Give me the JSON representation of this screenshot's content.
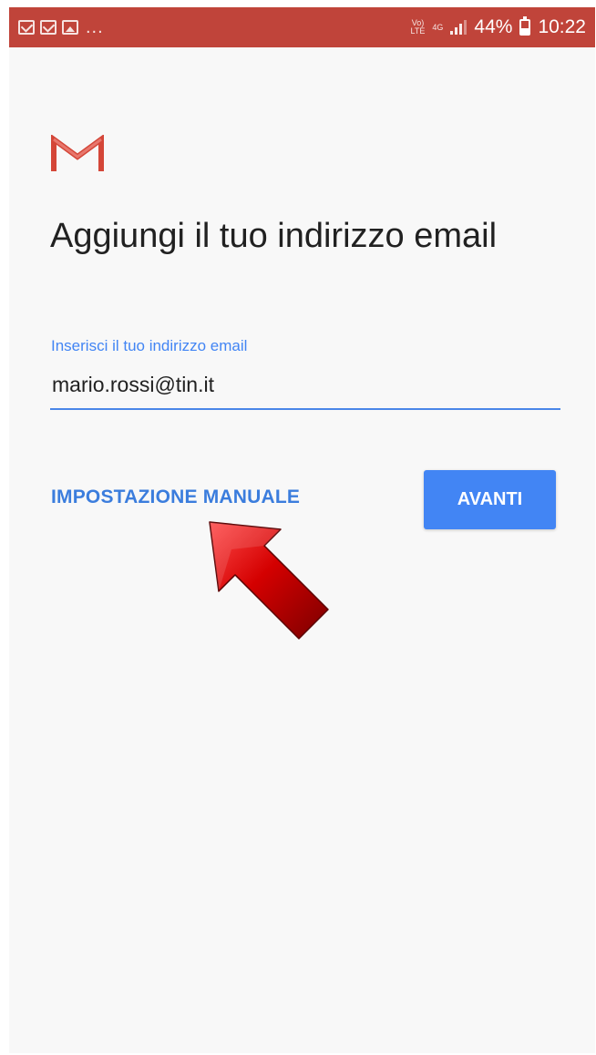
{
  "status_bar": {
    "background": "#c0443a",
    "notifications": [
      "email-icon",
      "email-icon",
      "image-icon"
    ],
    "overflow": "...",
    "volte": "Vo)\nLTE",
    "network": "4G",
    "battery": "44%",
    "time": "10:22"
  },
  "screen": {
    "title": "Aggiungi il tuo indirizzo email",
    "email_label": "Inserisci il tuo indirizzo email",
    "email_value": "mario.rossi@tin.it",
    "manual_setup": "IMPOSTAZIONE MANUALE",
    "next": "AVANTI"
  },
  "colors": {
    "accent": "#4285f4",
    "link": "#3b7ddd",
    "gmail_red": "#d44638",
    "annotation_arrow": "#c00000"
  },
  "annotation": {
    "icon": "red-arrow-icon",
    "points_to": "manual-setup-link"
  }
}
